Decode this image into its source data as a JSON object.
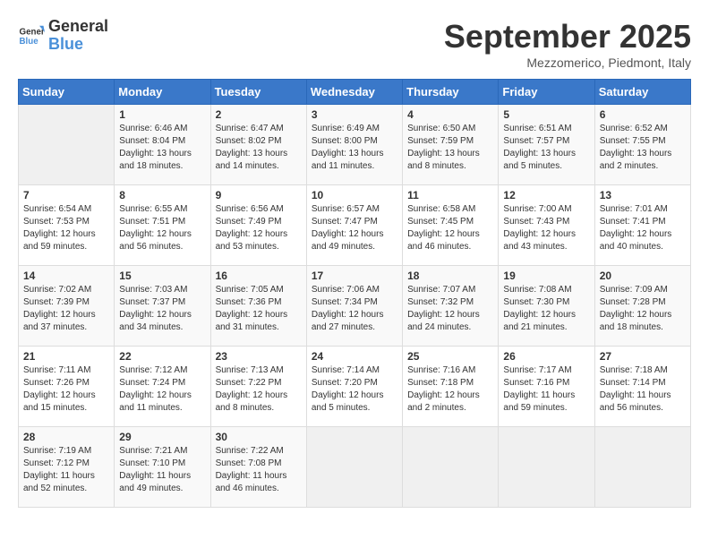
{
  "header": {
    "logo_line1": "General",
    "logo_line2": "Blue",
    "month_title": "September 2025",
    "location": "Mezzomerico, Piedmont, Italy"
  },
  "weekdays": [
    "Sunday",
    "Monday",
    "Tuesday",
    "Wednesday",
    "Thursday",
    "Friday",
    "Saturday"
  ],
  "weeks": [
    [
      {
        "day": "",
        "sunrise": "",
        "sunset": "",
        "daylight": ""
      },
      {
        "day": "1",
        "sunrise": "Sunrise: 6:46 AM",
        "sunset": "Sunset: 8:04 PM",
        "daylight": "Daylight: 13 hours and 18 minutes."
      },
      {
        "day": "2",
        "sunrise": "Sunrise: 6:47 AM",
        "sunset": "Sunset: 8:02 PM",
        "daylight": "Daylight: 13 hours and 14 minutes."
      },
      {
        "day": "3",
        "sunrise": "Sunrise: 6:49 AM",
        "sunset": "Sunset: 8:00 PM",
        "daylight": "Daylight: 13 hours and 11 minutes."
      },
      {
        "day": "4",
        "sunrise": "Sunrise: 6:50 AM",
        "sunset": "Sunset: 7:59 PM",
        "daylight": "Daylight: 13 hours and 8 minutes."
      },
      {
        "day": "5",
        "sunrise": "Sunrise: 6:51 AM",
        "sunset": "Sunset: 7:57 PM",
        "daylight": "Daylight: 13 hours and 5 minutes."
      },
      {
        "day": "6",
        "sunrise": "Sunrise: 6:52 AM",
        "sunset": "Sunset: 7:55 PM",
        "daylight": "Daylight: 13 hours and 2 minutes."
      }
    ],
    [
      {
        "day": "7",
        "sunrise": "Sunrise: 6:54 AM",
        "sunset": "Sunset: 7:53 PM",
        "daylight": "Daylight: 12 hours and 59 minutes."
      },
      {
        "day": "8",
        "sunrise": "Sunrise: 6:55 AM",
        "sunset": "Sunset: 7:51 PM",
        "daylight": "Daylight: 12 hours and 56 minutes."
      },
      {
        "day": "9",
        "sunrise": "Sunrise: 6:56 AM",
        "sunset": "Sunset: 7:49 PM",
        "daylight": "Daylight: 12 hours and 53 minutes."
      },
      {
        "day": "10",
        "sunrise": "Sunrise: 6:57 AM",
        "sunset": "Sunset: 7:47 PM",
        "daylight": "Daylight: 12 hours and 49 minutes."
      },
      {
        "day": "11",
        "sunrise": "Sunrise: 6:58 AM",
        "sunset": "Sunset: 7:45 PM",
        "daylight": "Daylight: 12 hours and 46 minutes."
      },
      {
        "day": "12",
        "sunrise": "Sunrise: 7:00 AM",
        "sunset": "Sunset: 7:43 PM",
        "daylight": "Daylight: 12 hours and 43 minutes."
      },
      {
        "day": "13",
        "sunrise": "Sunrise: 7:01 AM",
        "sunset": "Sunset: 7:41 PM",
        "daylight": "Daylight: 12 hours and 40 minutes."
      }
    ],
    [
      {
        "day": "14",
        "sunrise": "Sunrise: 7:02 AM",
        "sunset": "Sunset: 7:39 PM",
        "daylight": "Daylight: 12 hours and 37 minutes."
      },
      {
        "day": "15",
        "sunrise": "Sunrise: 7:03 AM",
        "sunset": "Sunset: 7:37 PM",
        "daylight": "Daylight: 12 hours and 34 minutes."
      },
      {
        "day": "16",
        "sunrise": "Sunrise: 7:05 AM",
        "sunset": "Sunset: 7:36 PM",
        "daylight": "Daylight: 12 hours and 31 minutes."
      },
      {
        "day": "17",
        "sunrise": "Sunrise: 7:06 AM",
        "sunset": "Sunset: 7:34 PM",
        "daylight": "Daylight: 12 hours and 27 minutes."
      },
      {
        "day": "18",
        "sunrise": "Sunrise: 7:07 AM",
        "sunset": "Sunset: 7:32 PM",
        "daylight": "Daylight: 12 hours and 24 minutes."
      },
      {
        "day": "19",
        "sunrise": "Sunrise: 7:08 AM",
        "sunset": "Sunset: 7:30 PM",
        "daylight": "Daylight: 12 hours and 21 minutes."
      },
      {
        "day": "20",
        "sunrise": "Sunrise: 7:09 AM",
        "sunset": "Sunset: 7:28 PM",
        "daylight": "Daylight: 12 hours and 18 minutes."
      }
    ],
    [
      {
        "day": "21",
        "sunrise": "Sunrise: 7:11 AM",
        "sunset": "Sunset: 7:26 PM",
        "daylight": "Daylight: 12 hours and 15 minutes."
      },
      {
        "day": "22",
        "sunrise": "Sunrise: 7:12 AM",
        "sunset": "Sunset: 7:24 PM",
        "daylight": "Daylight: 12 hours and 11 minutes."
      },
      {
        "day": "23",
        "sunrise": "Sunrise: 7:13 AM",
        "sunset": "Sunset: 7:22 PM",
        "daylight": "Daylight: 12 hours and 8 minutes."
      },
      {
        "day": "24",
        "sunrise": "Sunrise: 7:14 AM",
        "sunset": "Sunset: 7:20 PM",
        "daylight": "Daylight: 12 hours and 5 minutes."
      },
      {
        "day": "25",
        "sunrise": "Sunrise: 7:16 AM",
        "sunset": "Sunset: 7:18 PM",
        "daylight": "Daylight: 12 hours and 2 minutes."
      },
      {
        "day": "26",
        "sunrise": "Sunrise: 7:17 AM",
        "sunset": "Sunset: 7:16 PM",
        "daylight": "Daylight: 11 hours and 59 minutes."
      },
      {
        "day": "27",
        "sunrise": "Sunrise: 7:18 AM",
        "sunset": "Sunset: 7:14 PM",
        "daylight": "Daylight: 11 hours and 56 minutes."
      }
    ],
    [
      {
        "day": "28",
        "sunrise": "Sunrise: 7:19 AM",
        "sunset": "Sunset: 7:12 PM",
        "daylight": "Daylight: 11 hours and 52 minutes."
      },
      {
        "day": "29",
        "sunrise": "Sunrise: 7:21 AM",
        "sunset": "Sunset: 7:10 PM",
        "daylight": "Daylight: 11 hours and 49 minutes."
      },
      {
        "day": "30",
        "sunrise": "Sunrise: 7:22 AM",
        "sunset": "Sunset: 7:08 PM",
        "daylight": "Daylight: 11 hours and 46 minutes."
      },
      {
        "day": "",
        "sunrise": "",
        "sunset": "",
        "daylight": ""
      },
      {
        "day": "",
        "sunrise": "",
        "sunset": "",
        "daylight": ""
      },
      {
        "day": "",
        "sunrise": "",
        "sunset": "",
        "daylight": ""
      },
      {
        "day": "",
        "sunrise": "",
        "sunset": "",
        "daylight": ""
      }
    ]
  ]
}
